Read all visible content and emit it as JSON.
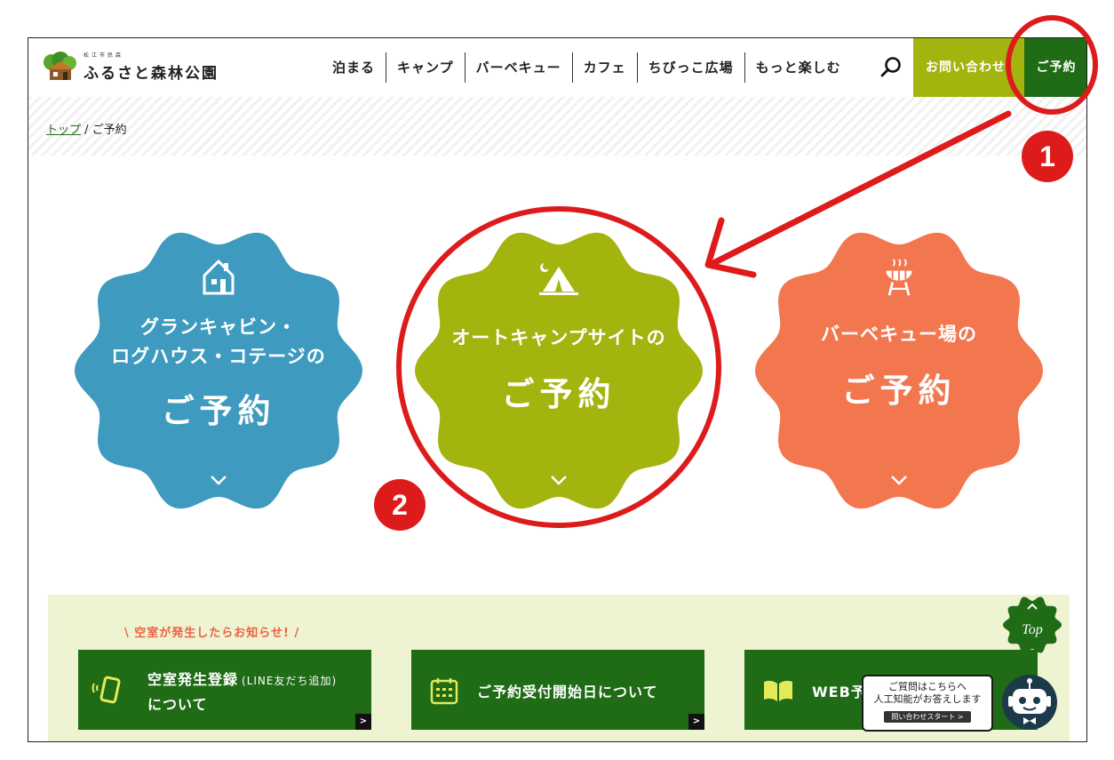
{
  "header": {
    "logo_small": "松江市民森",
    "logo_main": "ふるさと森林公園",
    "nav": [
      "泊まる",
      "キャンプ",
      "バーベキュー",
      "カフェ",
      "ちびっこ広場",
      "もっと楽しむ"
    ],
    "contact_label": "お問い合わせ",
    "reserve_label": "ご予約"
  },
  "breadcrumb": {
    "home": "トップ",
    "separator": " / ",
    "current": "ご予約"
  },
  "badges": [
    {
      "line1": "グランキャビン・",
      "line2": "ログハウス・コテージの",
      "big": "ご予約",
      "color": "#3e9bbf",
      "icon": "house-icon"
    },
    {
      "line1": "オートキャンプサイトの",
      "line2": "",
      "big": "ご予約",
      "color": "#a3b40e",
      "icon": "tent-icon"
    },
    {
      "line1": "バーベキュー場の",
      "line2": "",
      "big": "ご予約",
      "color": "#f2774f",
      "icon": "bbq-grill-icon"
    }
  ],
  "bottom": {
    "notice": "\\ 空室が発生したらお知らせ! /",
    "cards": [
      {
        "title": "空室発生登録",
        "sub": "(LINE友だち追加)",
        "line2": "について",
        "icon": "phone-icon"
      },
      {
        "title": "ご予約受付開始日について",
        "icon": "calendar-icon"
      },
      {
        "title": "WEB予",
        "icon": "book-icon"
      }
    ],
    "arrow": ">"
  },
  "top_button": "Top",
  "chat": {
    "line1": "ご質問はこちらへ",
    "line2": "人工知能がお答えします",
    "button": "問い合わせスタート >"
  },
  "annotations": {
    "step1": "1",
    "step2": "2",
    "color": "#dd1b1b"
  }
}
